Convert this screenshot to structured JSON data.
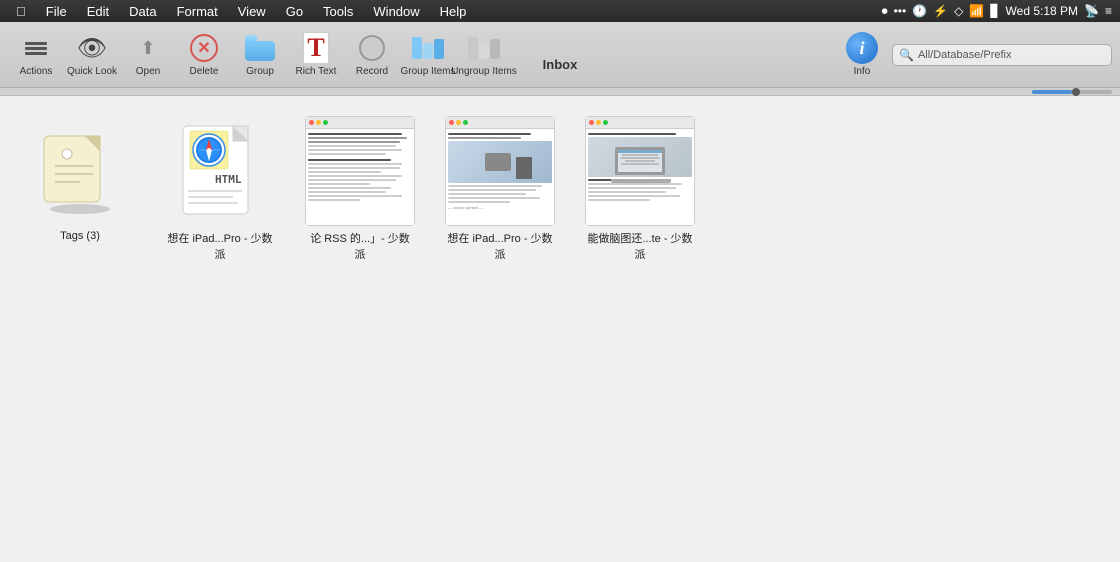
{
  "menubar": {
    "items": [
      "File",
      "Edit",
      "Data",
      "Format",
      "View",
      "Go",
      "Tools",
      "Window",
      "Help"
    ],
    "right": {
      "record_indicator": "⏺",
      "clock": "Wed 5:18 PM",
      "wifi": "WiFi",
      "battery": "🔋"
    }
  },
  "toolbar": {
    "title": "Inbox",
    "buttons": [
      {
        "id": "actions",
        "label": "Actions"
      },
      {
        "id": "quicklook",
        "label": "Quick Look"
      },
      {
        "id": "open",
        "label": "Open"
      },
      {
        "id": "delete",
        "label": "Delete"
      },
      {
        "id": "group",
        "label": "Group"
      },
      {
        "id": "richtext",
        "label": "Rich Text"
      },
      {
        "id": "record",
        "label": "Record"
      },
      {
        "id": "groupitems",
        "label": "Group Items"
      },
      {
        "id": "ungroupitems",
        "label": "Ungroup Items"
      }
    ],
    "info_label": "Info",
    "search_placeholder": "All/Database/Prefix"
  },
  "items": [
    {
      "id": "tags",
      "label": "Tags (3)",
      "type": "tag"
    },
    {
      "id": "html1",
      "label": "想在 iPad...Pro - 少数派",
      "type": "html"
    },
    {
      "id": "web1",
      "label": "论 RSS 的...」- 少数派",
      "type": "webpage_text"
    },
    {
      "id": "web2",
      "label": "想在 iPad...Pro - 少数派",
      "type": "webpage_photo"
    },
    {
      "id": "web3",
      "label": "能做脑图还...te - 少数派",
      "type": "webpage_laptop"
    }
  ]
}
